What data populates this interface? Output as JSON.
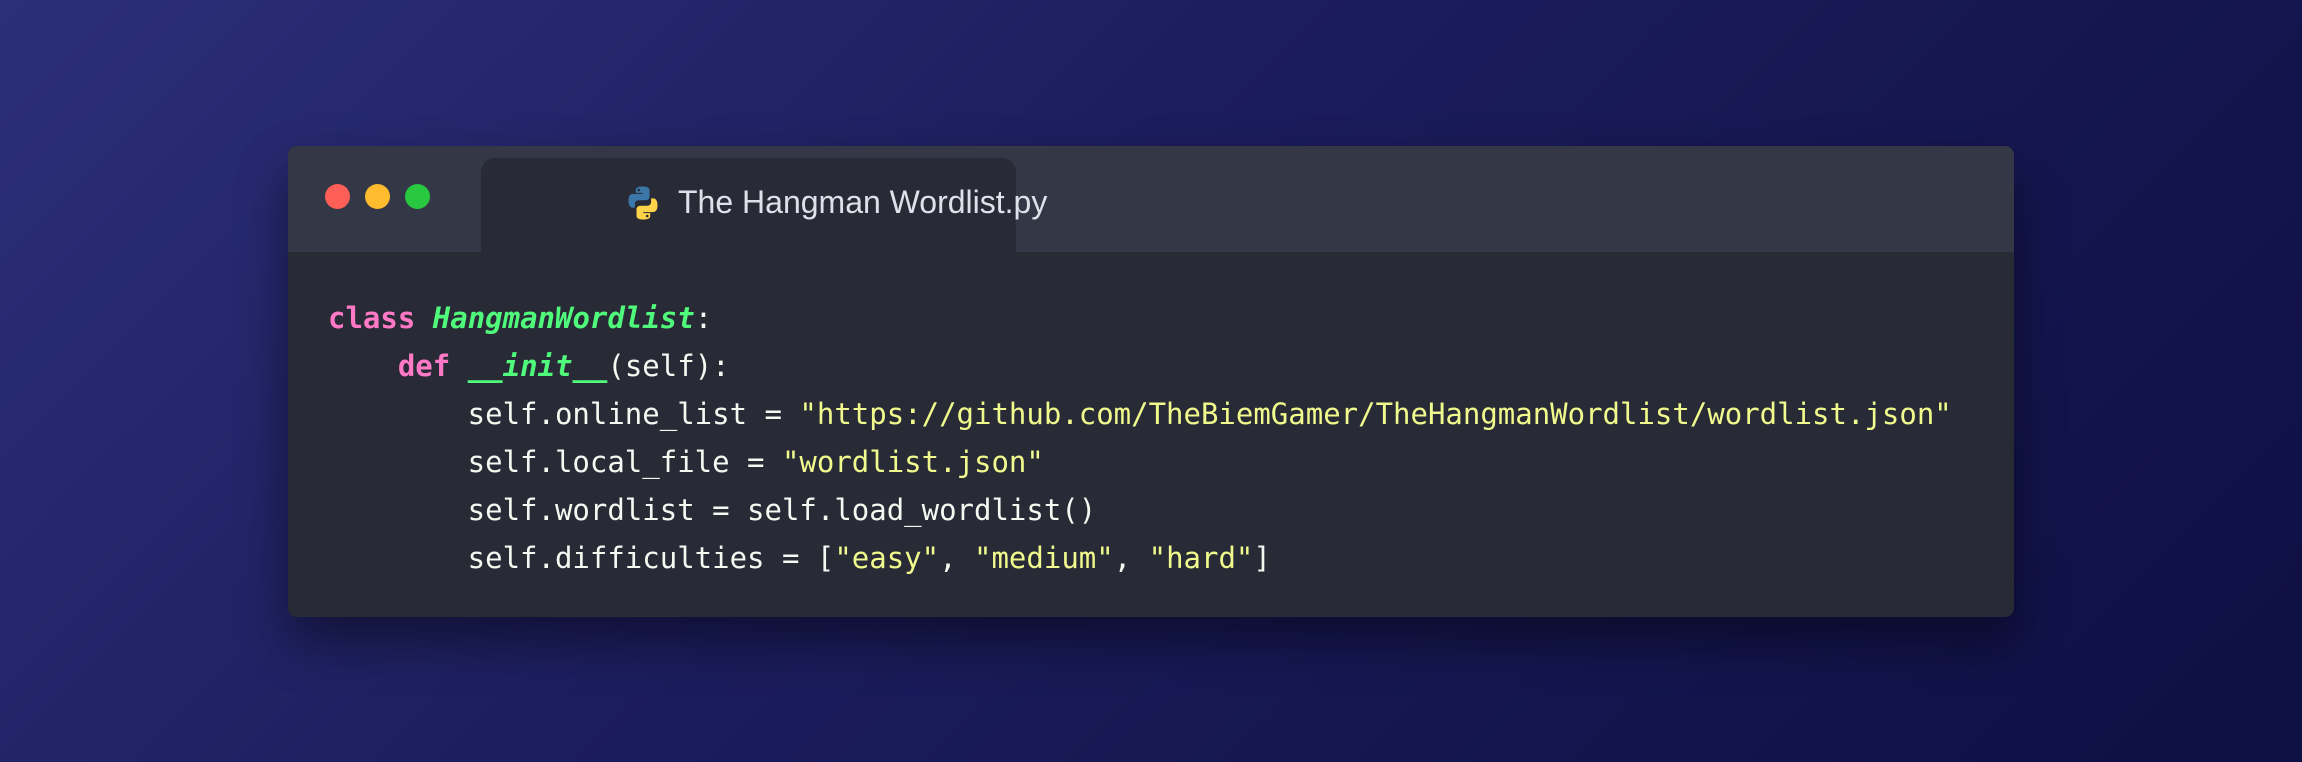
{
  "window": {
    "controls": [
      {
        "name": "close",
        "color": "#ff5f57"
      },
      {
        "name": "minimize",
        "color": "#febc2e"
      },
      {
        "name": "maximize",
        "color": "#28c840"
      }
    ],
    "tab": {
      "icon": "python-icon",
      "title": "The Hangman Wordlist.py"
    }
  },
  "theme": {
    "keyword": "#ff79c6",
    "function": "#50fa7b",
    "string": "#f1fa8c",
    "text": "#f8f8f2",
    "editor_background": "#282a36",
    "titlebar_background": "#343746"
  },
  "code": {
    "line1": {
      "kw": "class",
      "sp": " ",
      "name": "HangmanWordlist",
      "rest": ":"
    },
    "line2": {
      "indent": "    ",
      "kw": "def",
      "sp": " ",
      "name": "__init__",
      "rest": "(self):"
    },
    "line3": {
      "text": "        self.online_list = ",
      "str": "\"https://github.com/TheBiemGamer/TheHangmanWordlist/wordlist.json\""
    },
    "line4": {
      "text": "        self.local_file = ",
      "str": "\"wordlist.json\""
    },
    "line5": {
      "text": "        self.wordlist = self.load_wordlist()"
    },
    "line6": {
      "text": "        self.difficulties = [",
      "s1": "\"easy\"",
      "c1": ", ",
      "s2": "\"medium\"",
      "c2": ", ",
      "s3": "\"hard\"",
      "end": "]"
    }
  }
}
